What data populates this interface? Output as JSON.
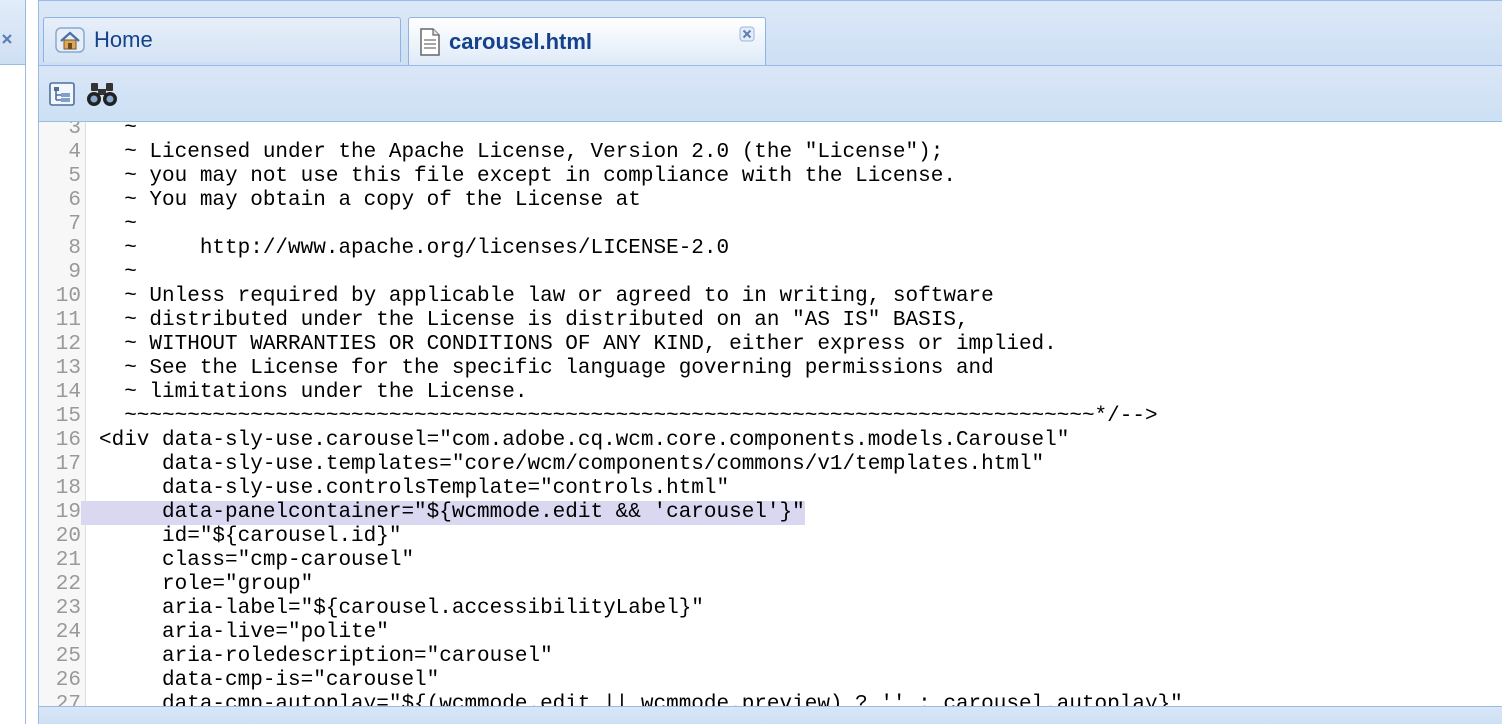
{
  "tabs": {
    "home_label": "Home",
    "active_label": "carousel.html"
  },
  "icons": {
    "left_close": "close-icon",
    "home": "home-icon",
    "file": "file-icon",
    "tab_close": "close-icon",
    "tree": "tree-view-icon",
    "find": "binoculars-icon"
  },
  "editor": {
    "highlight_line": 19,
    "lines": [
      {
        "n": "3",
        "text": "  ~"
      },
      {
        "n": "4",
        "text": "  ~ Licensed under the Apache License, Version 2.0 (the \"License\");"
      },
      {
        "n": "5",
        "text": "  ~ you may not use this file except in compliance with the License."
      },
      {
        "n": "6",
        "text": "  ~ You may obtain a copy of the License at"
      },
      {
        "n": "7",
        "text": "  ~"
      },
      {
        "n": "8",
        "text": "  ~     http://www.apache.org/licenses/LICENSE-2.0"
      },
      {
        "n": "9",
        "text": "  ~"
      },
      {
        "n": "10",
        "text": "  ~ Unless required by applicable law or agreed to in writing, software"
      },
      {
        "n": "11",
        "text": "  ~ distributed under the License is distributed on an \"AS IS\" BASIS,"
      },
      {
        "n": "12",
        "text": "  ~ WITHOUT WARRANTIES OR CONDITIONS OF ANY KIND, either express or implied."
      },
      {
        "n": "13",
        "text": "  ~ See the License for the specific language governing permissions and"
      },
      {
        "n": "14",
        "text": "  ~ limitations under the License."
      },
      {
        "n": "15",
        "text": "  ~~~~~~~~~~~~~~~~~~~~~~~~~~~~~~~~~~~~~~~~~~~~~~~~~~~~~~~~~~~~~~~~~~~~~~~~~~~~~*/-->"
      },
      {
        "n": "16",
        "text": "<div data-sly-use.carousel=\"com.adobe.cq.wcm.core.components.models.Carousel\""
      },
      {
        "n": "17",
        "text": "     data-sly-use.templates=\"core/wcm/components/commons/v1/templates.html\""
      },
      {
        "n": "18",
        "text": "     data-sly-use.controlsTemplate=\"controls.html\""
      },
      {
        "n": "19",
        "text": "     data-panelcontainer=\"${wcmmode.edit && 'carousel'}\""
      },
      {
        "n": "20",
        "text": "     id=\"${carousel.id}\""
      },
      {
        "n": "21",
        "text": "     class=\"cmp-carousel\""
      },
      {
        "n": "22",
        "text": "     role=\"group\""
      },
      {
        "n": "23",
        "text": "     aria-label=\"${carousel.accessibilityLabel}\""
      },
      {
        "n": "24",
        "text": "     aria-live=\"polite\""
      },
      {
        "n": "25",
        "text": "     aria-roledescription=\"carousel\""
      },
      {
        "n": "26",
        "text": "     data-cmp-is=\"carousel\""
      },
      {
        "n": "27",
        "text": "     data-cmp-autoplay=\"${(wcmmode.edit || wcmmode.preview) ? '' : carousel.autoplay}\""
      }
    ]
  }
}
